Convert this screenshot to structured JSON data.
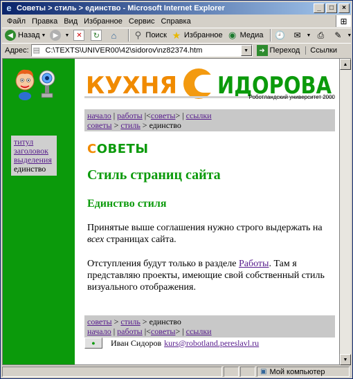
{
  "window": {
    "title": "Советы > стиль > единство - Microsoft Internet Explorer",
    "minimize": "_",
    "maximize": "□",
    "close": "×"
  },
  "menu": [
    "Файл",
    "Правка",
    "Вид",
    "Избранное",
    "Сервис",
    "Справка"
  ],
  "toolbar": {
    "back": "Назад",
    "search": "Поиск",
    "favorites": "Избранное",
    "media": "Медиа"
  },
  "address": {
    "label": "Адрес:",
    "url": "C:\\TEXTS\\UNIVER00\\42\\sidorov\\nz82374.htm",
    "go": "Переход",
    "links": "Ссылки"
  },
  "logo": {
    "word1": "КУХНЯ",
    "word2_first": "С",
    "word2_rest": "ИДОРОВА",
    "subtitle": "Роботландский университет 2000"
  },
  "sidenav": [
    {
      "label": "титул",
      "link": true
    },
    {
      "label": "заголовок",
      "link": true
    },
    {
      "label": "выделения",
      "link": true
    },
    {
      "label": "единство",
      "link": false
    }
  ],
  "crumbs": {
    "top_line1": {
      "a": "начало",
      "b": "работы",
      "c": "советы",
      "d": "ссылки"
    },
    "line2": {
      "a": "советы",
      "b": "стиль",
      "cur": "единство"
    }
  },
  "section": {
    "first": "С",
    "rest": "ОВЕТЫ"
  },
  "page_title": "Стиль страниц сайта",
  "subtitle": "Единство стиля",
  "para1": {
    "pre": "Принятые выше соглашения нужно строго выдержать на ",
    "em": "всех",
    "post": " страницах сайта."
  },
  "para2": {
    "pre": "Отступления будут только в разделе ",
    "link": "Работы",
    "post": ". Там я представляю проекты, имеющие свой собственный стиль визуального отображения."
  },
  "footer": {
    "name": "Иван Сидоров",
    "email": "kurs@robotland.pereslavl.ru"
  },
  "status": {
    "zone": "Мой компьютер"
  }
}
